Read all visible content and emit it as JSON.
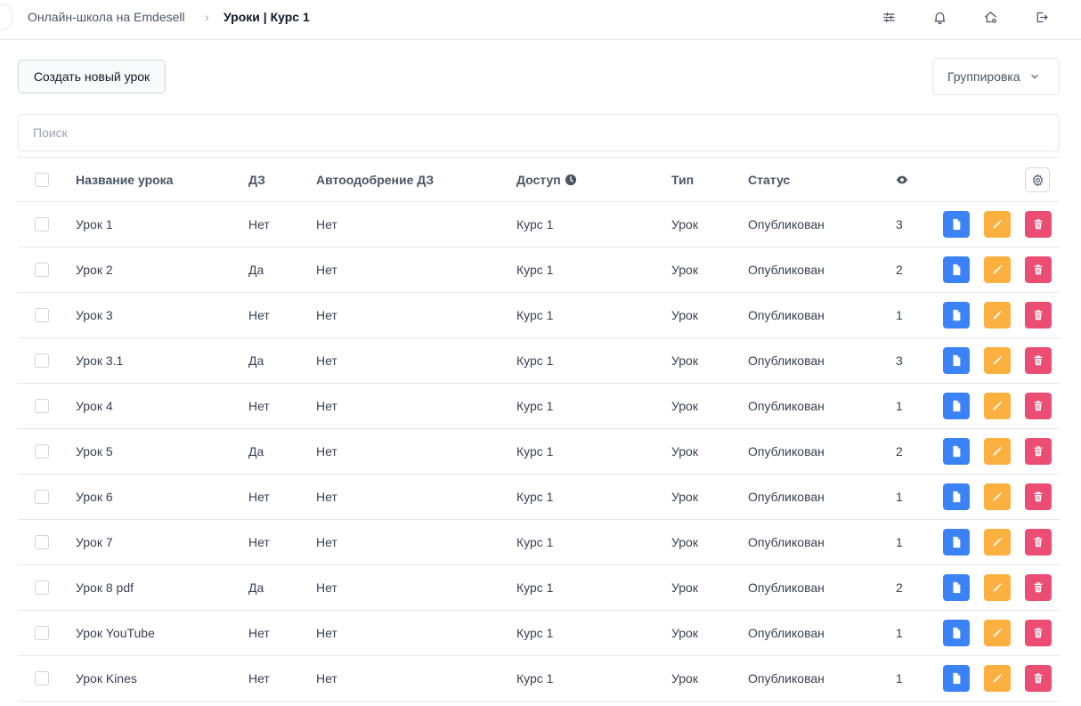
{
  "breadcrumb": {
    "school": "Онлайн-школа на Emdesell",
    "separator": "›",
    "current": "Уроки | Курс 1"
  },
  "toolbar": {
    "create_label": "Создать новый урок",
    "grouping_label": "Группировка"
  },
  "search": {
    "placeholder": "Поиск",
    "value": ""
  },
  "icons": {
    "filters": "sliders-icon",
    "notifications": "bell-icon",
    "home": "home-settings-icon",
    "logout": "logout-icon",
    "info": "clock-icon",
    "views": "eye-icon",
    "column_settings": "gear-icon",
    "view_action": "document-icon",
    "edit_action": "pencil-icon",
    "delete_action": "trash-icon"
  },
  "colors": {
    "view_button": "#3b82f6",
    "edit_button": "#fbb040",
    "delete_button": "#ec4e73"
  },
  "table": {
    "headers": {
      "name": "Название урока",
      "homework": "ДЗ",
      "auto_approve": "Автоодобрение ДЗ",
      "access": "Доступ",
      "type": "Тип",
      "status": "Статус"
    },
    "rows": [
      {
        "name": "Урок 1",
        "homework": "Нет",
        "auto_approve": "Нет",
        "access": "Курс 1",
        "type": "Урок",
        "status": "Опубликован",
        "views": "3"
      },
      {
        "name": "Урок 2",
        "homework": "Да",
        "auto_approve": "Нет",
        "access": "Курс 1",
        "type": "Урок",
        "status": "Опубликован",
        "views": "2"
      },
      {
        "name": "Урок 3",
        "homework": "Нет",
        "auto_approve": "Нет",
        "access": "Курс 1",
        "type": "Урок",
        "status": "Опубликован",
        "views": "1"
      },
      {
        "name": "Урок 3.1",
        "homework": "Да",
        "auto_approve": "Нет",
        "access": "Курс 1",
        "type": "Урок",
        "status": "Опубликован",
        "views": "3"
      },
      {
        "name": "Урок 4",
        "homework": "Нет",
        "auto_approve": "Нет",
        "access": "Курс 1",
        "type": "Урок",
        "status": "Опубликован",
        "views": "1"
      },
      {
        "name": "Урок 5",
        "homework": "Да",
        "auto_approve": "Нет",
        "access": "Курс 1",
        "type": "Урок",
        "status": "Опубликован",
        "views": "2"
      },
      {
        "name": "Урок 6",
        "homework": "Нет",
        "auto_approve": "Нет",
        "access": "Курс 1",
        "type": "Урок",
        "status": "Опубликован",
        "views": "1"
      },
      {
        "name": "Урок 7",
        "homework": "Нет",
        "auto_approve": "Нет",
        "access": "Курс 1",
        "type": "Урок",
        "status": "Опубликован",
        "views": "1"
      },
      {
        "name": "Урок 8 pdf",
        "homework": "Да",
        "auto_approve": "Нет",
        "access": "Курс 1",
        "type": "Урок",
        "status": "Опубликован",
        "views": "2"
      },
      {
        "name": "Урок YouTube",
        "homework": "Нет",
        "auto_approve": "Нет",
        "access": "Курс 1",
        "type": "Урок",
        "status": "Опубликован",
        "views": "1"
      },
      {
        "name": "Урок Kines",
        "homework": "Нет",
        "auto_approve": "Нет",
        "access": "Курс 1",
        "type": "Урок",
        "status": "Опубликован",
        "views": "1"
      }
    ]
  }
}
